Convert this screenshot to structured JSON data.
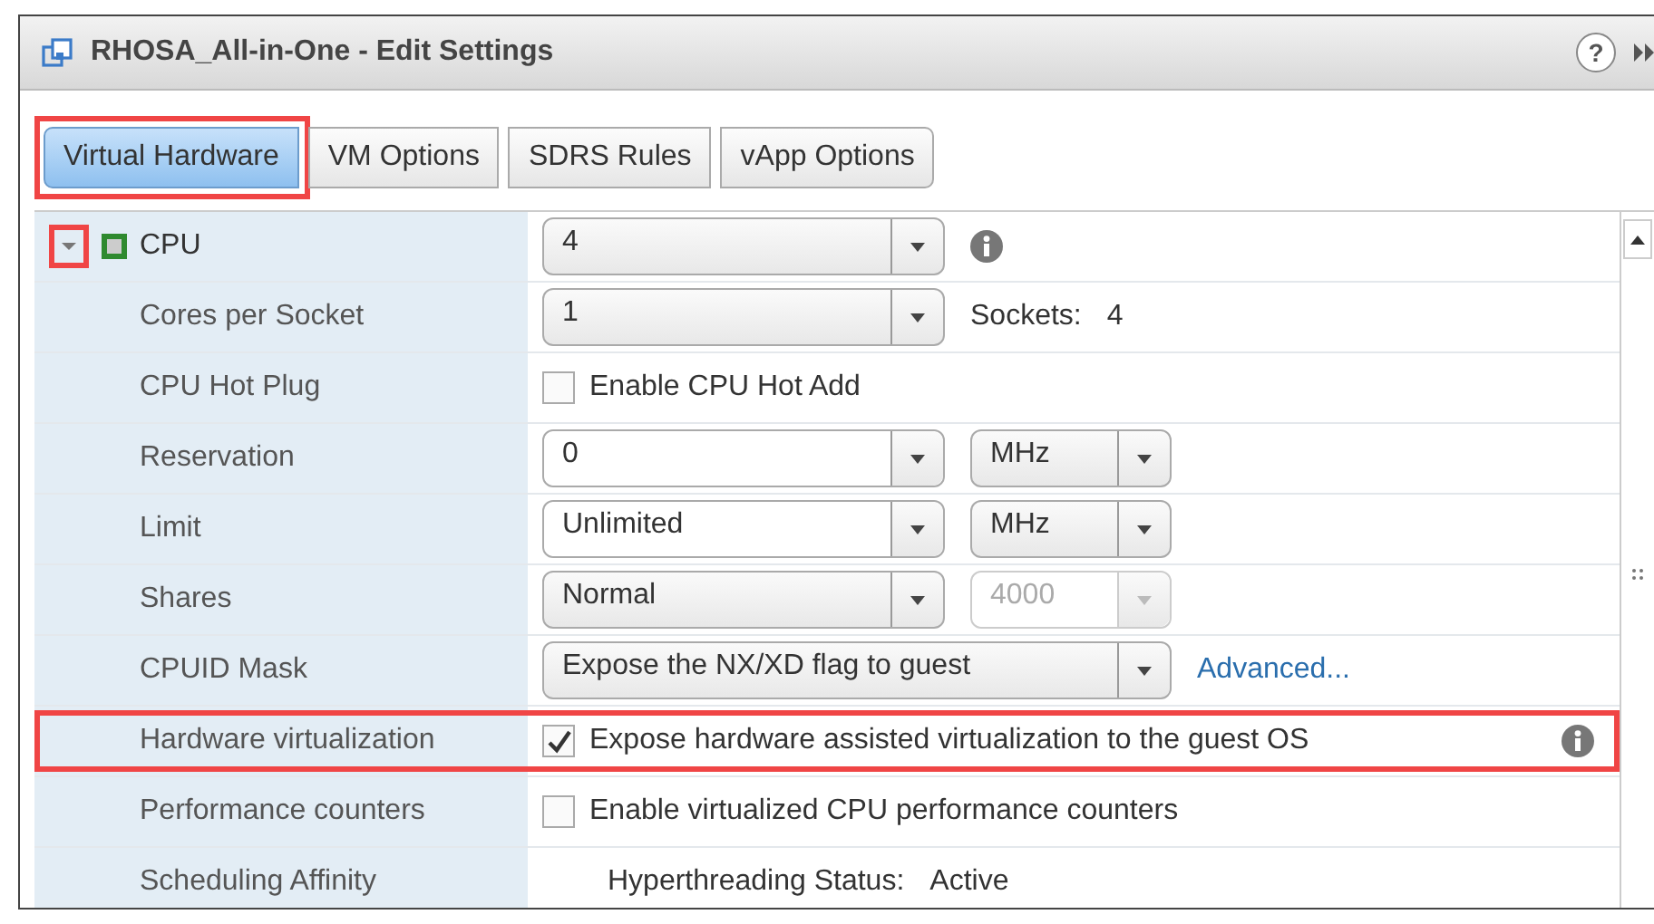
{
  "window": {
    "title": "RHOSA_All-in-One - Edit Settings",
    "help_button": "?"
  },
  "tabs": [
    {
      "label": "Virtual Hardware",
      "selected": true,
      "highlighted": true
    },
    {
      "label": "VM Options",
      "selected": false,
      "highlighted": false
    },
    {
      "label": "SDRS Rules",
      "selected": false,
      "highlighted": false
    },
    {
      "label": "vApp Options",
      "selected": false,
      "highlighted": false
    }
  ],
  "rows": [
    {
      "label": "CPU",
      "expanded": true,
      "highlighted": false,
      "expander_highlighted": true,
      "controls": [
        {
          "kind": "select",
          "value": "4"
        },
        {
          "kind": "info"
        }
      ]
    },
    {
      "label": "Cores per Socket",
      "highlighted": false,
      "controls": [
        {
          "kind": "select",
          "value": "1"
        },
        {
          "kind": "text",
          "value": "Sockets:"
        },
        {
          "kind": "text",
          "value": "4"
        }
      ]
    },
    {
      "label": "CPU Hot Plug",
      "highlighted": false,
      "controls": [
        {
          "kind": "checkbox",
          "checked": false,
          "value": "Enable CPU Hot Add"
        }
      ]
    },
    {
      "label": "Reservation",
      "highlighted": false,
      "controls": [
        {
          "kind": "combo",
          "value": "0",
          "disabled": false
        },
        {
          "kind": "select",
          "value": "MHz"
        }
      ]
    },
    {
      "label": "Limit",
      "highlighted": false,
      "controls": [
        {
          "kind": "combo",
          "value": "Unlimited",
          "disabled": false
        },
        {
          "kind": "select",
          "value": "MHz"
        }
      ]
    },
    {
      "label": "Shares",
      "highlighted": false,
      "controls": [
        {
          "kind": "select",
          "value": "Normal"
        },
        {
          "kind": "combo",
          "value": "4000",
          "disabled": true
        }
      ]
    },
    {
      "label": "CPUID Mask",
      "highlighted": false,
      "controls": [
        {
          "kind": "select",
          "value": "Expose the NX/XD flag to guest"
        },
        {
          "kind": "link",
          "value": "Advanced..."
        }
      ]
    },
    {
      "label": "Hardware virtualization",
      "highlighted": true,
      "controls": [
        {
          "kind": "checkbox",
          "checked": true,
          "value": "Expose hardware assisted virtualization to the guest OS"
        },
        {
          "kind": "info"
        }
      ]
    },
    {
      "label": "Performance counters",
      "highlighted": false,
      "controls": [
        {
          "kind": "checkbox",
          "checked": false,
          "value": "Enable virtualized CPU performance counters"
        }
      ]
    },
    {
      "label": "Scheduling Affinity",
      "highlighted": false,
      "controls": [
        {
          "kind": "text",
          "value": "Hyperthreading Status:"
        },
        {
          "kind": "text",
          "value": "Active"
        }
      ]
    }
  ]
}
